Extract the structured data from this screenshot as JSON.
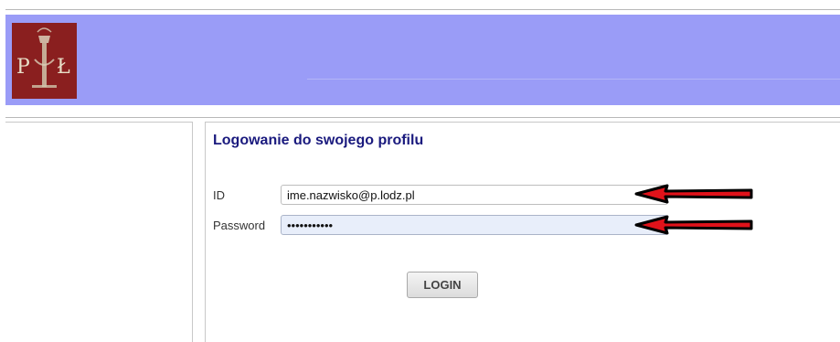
{
  "header": {
    "logo_text": "P Ł",
    "logo_icon": "university-logo-icon"
  },
  "login": {
    "title": "Logowanie do swojego profilu",
    "id_label": "ID",
    "id_value": "ime.nazwisko@p.lodz.pl",
    "password_label": "Password",
    "password_value": "•••••••••••",
    "submit_label": "LOGIN"
  },
  "annotations": {
    "arrow_icon": "red-arrow-icon",
    "arrow_color": "#e0121a"
  },
  "colors": {
    "banner": "#9a9cf7",
    "logo_background": "#8a1f1f",
    "title": "#1a1a7e"
  }
}
